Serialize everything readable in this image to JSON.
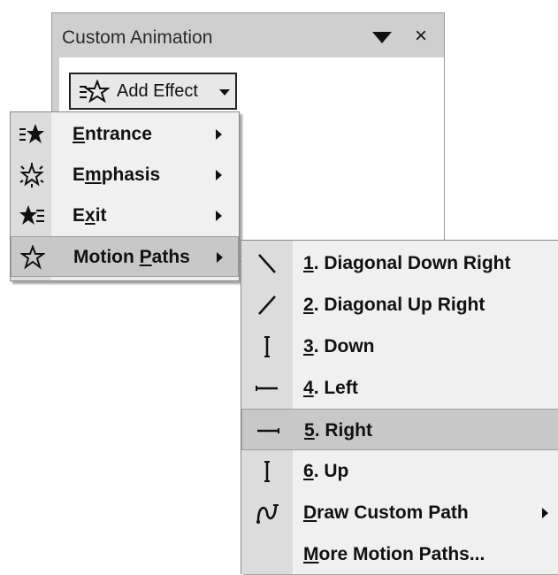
{
  "pane": {
    "title": "Custom Animation",
    "close": "×"
  },
  "add_effect": {
    "label": "Add Effect"
  },
  "menu": {
    "items": [
      {
        "pre": "",
        "key": "E",
        "post": "ntrance",
        "icon": "entrance-star-icon"
      },
      {
        "pre": "E",
        "key": "m",
        "post": "phasis",
        "icon": "emphasis-star-icon"
      },
      {
        "pre": "E",
        "key": "x",
        "post": "it",
        "icon": "exit-star-icon"
      },
      {
        "pre": "Motion ",
        "key": "P",
        "post": "aths",
        "icon": "motion-path-star-icon"
      }
    ]
  },
  "submenu": {
    "items": [
      {
        "key": "1",
        "post": ". Diagonal Down Right",
        "icon": "diagonal-down-right-icon"
      },
      {
        "key": "2",
        "post": ". Diagonal Up Right",
        "icon": "diagonal-up-right-icon"
      },
      {
        "key": "3",
        "post": ". Down",
        "icon": "down-line-icon"
      },
      {
        "key": "4",
        "post": ". Left",
        "icon": "left-line-icon"
      },
      {
        "key": "5",
        "post": ". Right",
        "icon": "right-line-icon"
      },
      {
        "key": "6",
        "post": ". Up",
        "icon": "up-line-icon"
      },
      {
        "key": "D",
        "post": "raw Custom Path",
        "icon": "custom-path-icon"
      },
      {
        "key": "M",
        "post": "ore Motion Paths...",
        "icon": ""
      }
    ]
  }
}
